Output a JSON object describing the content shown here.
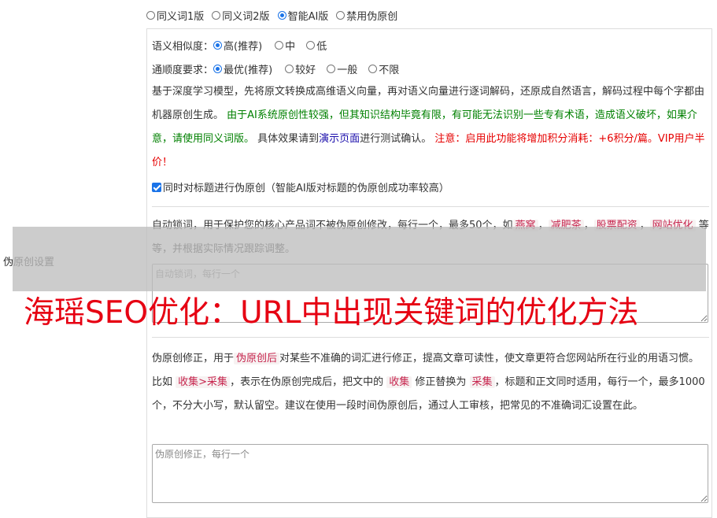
{
  "side_label": "伪原创设置",
  "top_radios": [
    {
      "label": "同义词1版",
      "checked": false
    },
    {
      "label": "同义词2版",
      "checked": false
    },
    {
      "label": "智能AI版",
      "checked": true
    },
    {
      "label": "禁用伪原创",
      "checked": false
    }
  ],
  "similarity": {
    "label": "语义相似度：",
    "options": [
      {
        "label": "高(推荐)",
        "checked": true
      },
      {
        "label": "中",
        "checked": false
      },
      {
        "label": "低",
        "checked": false
      }
    ]
  },
  "fluency": {
    "label": "通顺度要求：",
    "options": [
      {
        "label": "最优(推荐)",
        "checked": true
      },
      {
        "label": "较好",
        "checked": false
      },
      {
        "label": "一般",
        "checked": false
      },
      {
        "label": "不限",
        "checked": false
      }
    ]
  },
  "description": {
    "part1": "基于深度学习模型，先将原文转换成高维语义向量，再对语义向量进行逐词解码，还原成自然语言，解码过程中每个字都由机器原创生成。",
    "green": "由于AI系统原创性较强，但其知识结构毕竟有限，有可能无法识别一些专有术语，造成语义破坏，如果介意，请使用同义词版。",
    "part2": "具体效果请到",
    "link": "演示页面",
    "part3": "进行测试确认。",
    "red": "注意：启用此功能将增加积分消耗：+6积分/篇。VIP用户半价！"
  },
  "title_checkbox": {
    "label": "同时对标题进行伪原创（智能AI版对标题的伪原创成功率较高）",
    "checked": true
  },
  "lock_words": {
    "intro": "自动锁词，用于保护您的核心产品词不被伪原创修改，每行一个，最多50个，如",
    "examples": [
      "燕窝",
      "减肥茶",
      "股票配资",
      "网站优化"
    ],
    "sep": "，",
    "outro": "等等，并根据实际情况跟踪调整。",
    "placeholder": "自动锁词，每行一个"
  },
  "correction": {
    "t1": "伪原创修正，用于",
    "c1": "伪原创后",
    "t2": "对某些不准确的词汇进行修正，提高文章可读性，使文章更符合您网站所在行业的用语习惯。比如",
    "c2": "收集>采集",
    "t3": "，表示在伪原创完成后，把文中的",
    "c3": "收集",
    "t4": "修正替换为",
    "c4": "采集",
    "t5": "，标题和正文同时适用，每行一个，最多1000个，不分大小写，默认留空。建议在使用一段时间伪原创后，通过人工审核，把常见的不准确词汇设置在此。",
    "placeholder": "伪原创修正，每行一个"
  },
  "banner": "海瑶SEO优化：URL中出现关键词的优化方法",
  "colors": {
    "accent": "#1a73e8",
    "green": "#008000",
    "red": "#e60000",
    "banner": "#e60012"
  }
}
